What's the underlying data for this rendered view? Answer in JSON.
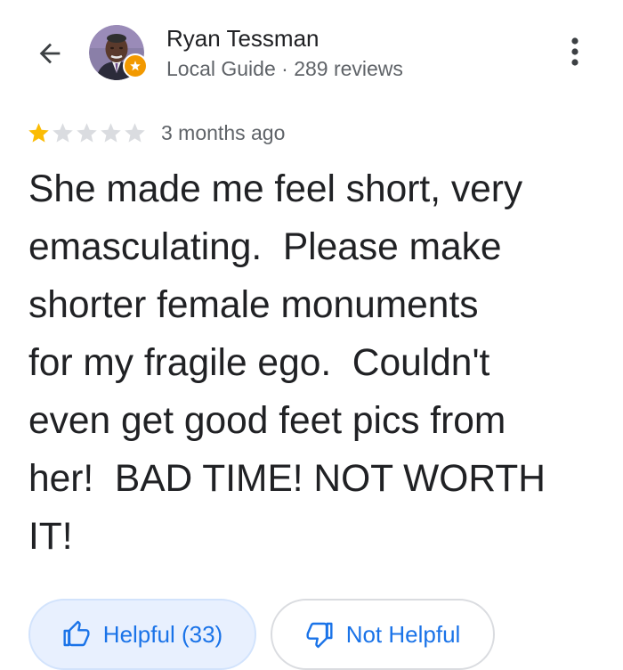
{
  "colors": {
    "accent": "#1a73e8",
    "star_filled": "#fbbc04",
    "star_empty": "#dadce0",
    "badge": "#f29900",
    "text_primary": "#202124",
    "text_secondary": "#5f6368"
  },
  "header": {
    "back_icon": "arrow-left-icon",
    "more_icon": "more-vert-icon"
  },
  "reviewer": {
    "name": "Ryan Tessman",
    "meta": "Local Guide · 289 reviews",
    "badge_icon": "local-guide-star-icon"
  },
  "review": {
    "rating": 1,
    "rating_max": 5,
    "date": "3 months ago",
    "text": "She made me feel short, very\nemasculating.  Please make\nshorter female monuments\nfor my fragile ego.  Couldn't\neven get good feet pics from\nher!  BAD TIME! NOT WORTH\nIT!"
  },
  "actions": {
    "helpful_label": "Helpful (33)",
    "helpful_icon": "thumb-up-icon",
    "not_helpful_label": "Not Helpful",
    "not_helpful_icon": "thumb-down-icon"
  }
}
